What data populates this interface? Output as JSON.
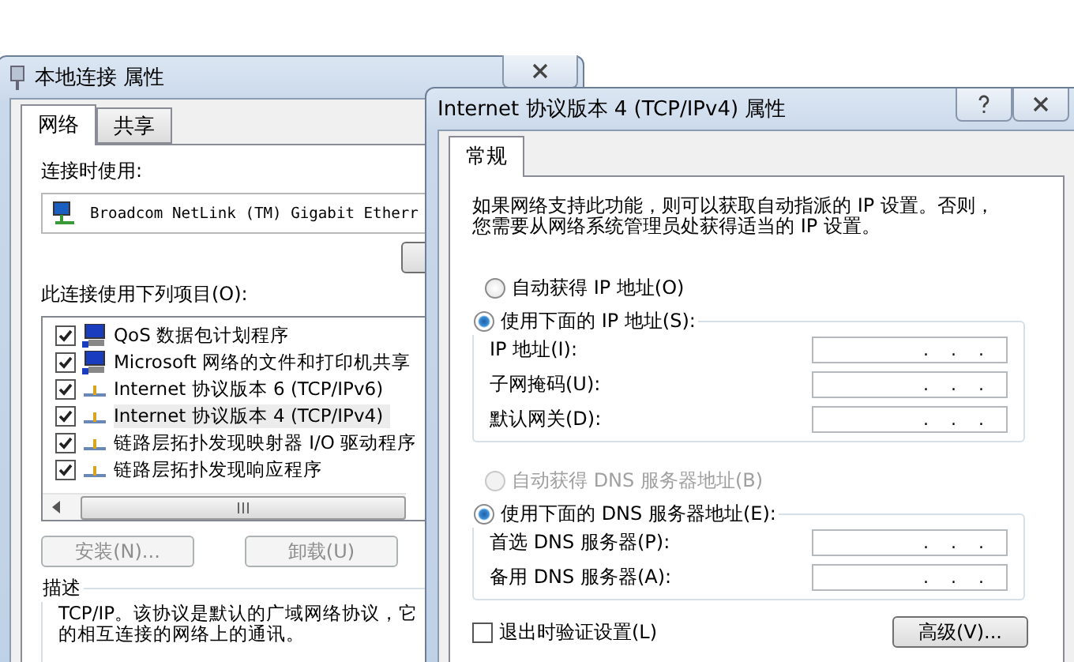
{
  "left_window": {
    "title": "本地连接 属性",
    "tabs": [
      {
        "label": "网络",
        "selected": true
      },
      {
        "label": "共享",
        "selected": false
      }
    ],
    "connect_using_label": "连接时使用:",
    "adapter": "Broadcom NetLink (TM) Gigabit Etherr",
    "items_label": "此连接使用下列项目(O):",
    "items": [
      {
        "label": "QoS 数据包计划程序",
        "checked": true,
        "selected": false,
        "kind": "service"
      },
      {
        "label": "Microsoft 网络的文件和打印机共享",
        "checked": true,
        "selected": false,
        "kind": "service"
      },
      {
        "label": "Internet 协议版本 6 (TCP/IPv6)",
        "checked": true,
        "selected": false,
        "kind": "protocol"
      },
      {
        "label": "Internet 协议版本 4 (TCP/IPv4)",
        "checked": true,
        "selected": true,
        "kind": "protocol"
      },
      {
        "label": "链路层拓扑发现映射器 I/O 驱动程序",
        "checked": true,
        "selected": false,
        "kind": "protocol"
      },
      {
        "label": "链路层拓扑发现响应程序",
        "checked": true,
        "selected": false,
        "kind": "protocol"
      }
    ],
    "buttons": [
      {
        "label": "安装(N)...",
        "disabled": true
      },
      {
        "label": "卸载(U)",
        "disabled": true
      }
    ],
    "description": {
      "title": "描述",
      "lines": [
        "TCP/IP。该协议是默认的广域网络协议，它",
        "的相互连接的网络上的通讯。"
      ]
    }
  },
  "right_window": {
    "title": "Internet 协议版本 4 (TCP/IPv4) 属性",
    "tabs": [
      {
        "label": "常规",
        "selected": true
      }
    ],
    "intro_lines": [
      "如果网络支持此功能，则可以获取自动指派的 IP 设置。否则，",
      "您需要从网络系统管理员处获得适当的 IP 设置。"
    ],
    "ip_options": [
      {
        "label": "自动获得 IP 地址(O)",
        "selected": false,
        "disabled": false
      },
      {
        "label": "使用下面的 IP 地址(S):",
        "selected": true,
        "disabled": false
      }
    ],
    "ip_fields": [
      {
        "label": "IP 地址(I):",
        "value": ".    .    ."
      },
      {
        "label": "子网掩码(U):",
        "value": ".    .    ."
      },
      {
        "label": "默认网关(D):",
        "value": ".    .    ."
      }
    ],
    "dns_options": [
      {
        "label": "自动获得 DNS 服务器地址(B)",
        "selected": false,
        "disabled": true
      },
      {
        "label": "使用下面的 DNS 服务器地址(E):",
        "selected": true,
        "disabled": false
      }
    ],
    "dns_fields": [
      {
        "label": "首选 DNS 服务器(P):",
        "value": ".    .    ."
      },
      {
        "label": "备用 DNS 服务器(A):",
        "value": ".    .    ."
      }
    ],
    "validate": {
      "label": "退出时验证设置(L)",
      "checked": false
    },
    "advanced_button": "高级(V)..."
  }
}
